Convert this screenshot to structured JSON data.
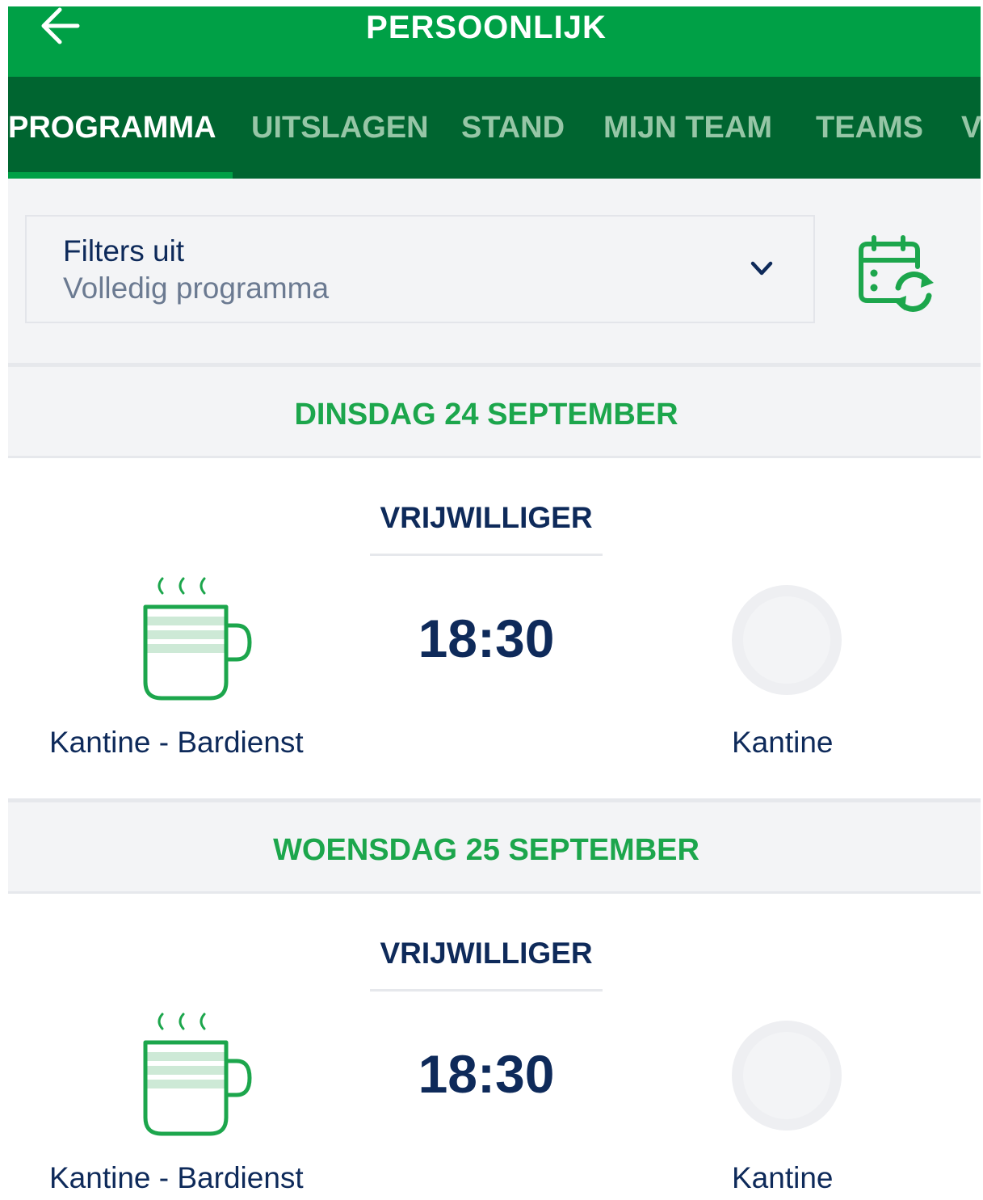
{
  "header": {
    "title": "PERSOONLIJK",
    "back_icon": "arrow-left-icon"
  },
  "tabs": [
    {
      "label": "PROGRAMMA",
      "active": true
    },
    {
      "label": "UITSLAGEN",
      "active": false
    },
    {
      "label": "STAND",
      "active": false
    },
    {
      "label": "MIJN TEAM",
      "active": false
    },
    {
      "label": "TEAMS",
      "active": false
    },
    {
      "label": "V",
      "active": false
    }
  ],
  "filter": {
    "title": "Filters uit",
    "subtitle": "Volledig programma",
    "dropdown_icon": "chevron-down-icon",
    "calendar_sync_icon": "calendar-sync-icon"
  },
  "days": [
    {
      "date": "DINSDAG 24 SEPTEMBER",
      "items": [
        {
          "category": "VRIJWILLIGER",
          "time": "18:30",
          "left_label": "Kantine - Bardienst",
          "right_label": "Kantine",
          "icon": "coffee-cup-icon"
        }
      ]
    },
    {
      "date": "WOENSDAG 25 SEPTEMBER",
      "items": [
        {
          "category": "VRIJWILLIGER",
          "time": "18:30",
          "left_label": "Kantine - Bardienst",
          "right_label": "Kantine",
          "icon": "coffee-cup-icon"
        }
      ]
    }
  ],
  "colors": {
    "brand_green": "#00a046",
    "tab_bar_green": "#006530",
    "navy_text": "#0e2a5a",
    "date_green": "#1ca64c",
    "background_gray": "#f3f4f6"
  }
}
